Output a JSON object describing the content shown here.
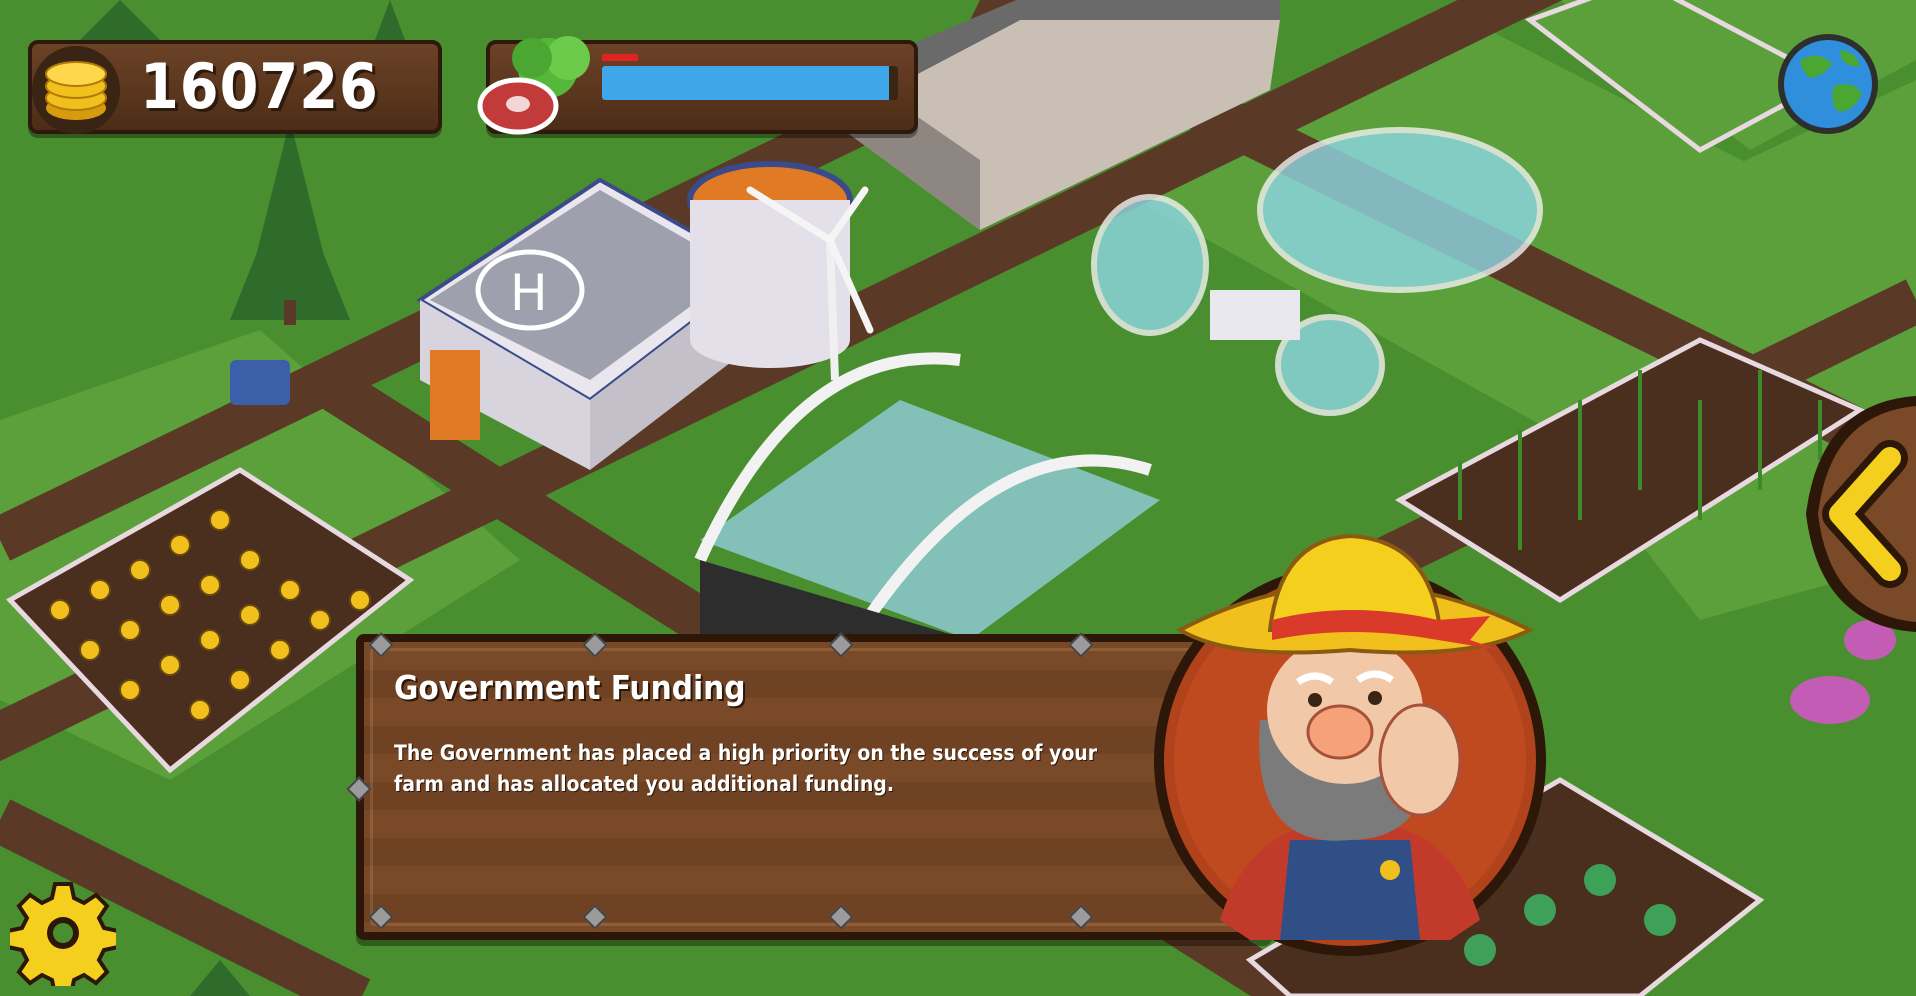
{
  "hud": {
    "coins": "160726",
    "food_level": 0.97,
    "food_warning": 0.12
  },
  "dialog": {
    "title": "Government Funding",
    "body": "The Government has placed a high priority on the success of your farm and has allocated you additional funding."
  },
  "icons": {
    "coins": "coin-stack-icon",
    "food": "meat-and-vegetable-icon",
    "world": "globe-icon",
    "back": "chevron-left-icon",
    "settings": "gear-icon",
    "advisor": "farmer-portrait"
  },
  "colors": {
    "grass": "#4a8f2f",
    "path": "#5a3a26",
    "wood": "#6e4223",
    "food_bar": "#3fa6ea",
    "gear": "#f5cf1d"
  }
}
